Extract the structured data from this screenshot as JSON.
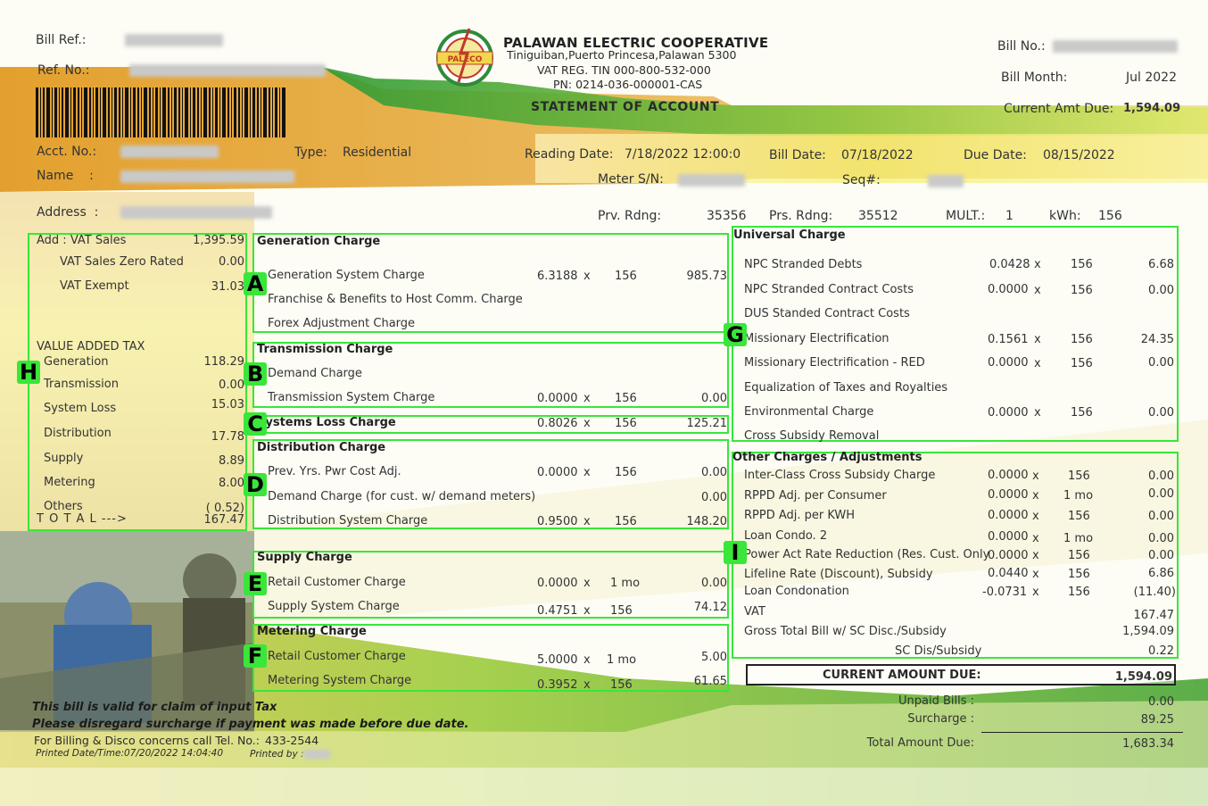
{
  "header": {
    "bill_ref_label": "Bill Ref.:",
    "ref_no_label": "Ref. No.:",
    "coop_name": "PALAWAN ELECTRIC COOPERATIVE",
    "coop_address": "Tiniguiban,Puerto Princesa,Palawan 5300",
    "vat_reg": "VAT REG. TIN 000-800-532-000",
    "pn": "PN: 0214-036-000001-CAS",
    "statement_title": "STATEMENT OF ACCOUNT",
    "logo_text": "PALECO",
    "bill_no_label": "Bill No.:",
    "bill_month_label": "Bill Month:",
    "bill_month": "Jul 2022",
    "current_amt_due_label": "Current Amt Due:",
    "current_amt_due": "1,594.09"
  },
  "account": {
    "acct_no_label": "Acct. No.:",
    "name_label": "Name    :",
    "address_label": "Address  :",
    "type_label": "Type:",
    "type": "Residential",
    "reading_date_label": "Reading Date:",
    "reading_date": "7/18/2022 12:00:0",
    "bill_date_label": "Bill Date:",
    "bill_date": "07/18/2022",
    "due_date_label": "Due Date:",
    "due_date": "08/15/2022",
    "meter_label": "Meter S/N:",
    "seq_label": "Seq#:",
    "prv_label": "Prv. Rdng:",
    "prv": "35356",
    "prs_label": "Prs. Rdng:",
    "prs": "35512",
    "mult_label": "MULT.:",
    "mult": "1",
    "kwh_label": "kWh:",
    "kwh": "156"
  },
  "vat_panel": {
    "add_vat_sales": "Add : VAT Sales",
    "add_vat_sales_val": "1,395.59",
    "zero_rated": "VAT Sales Zero Rated",
    "zero_rated_val": "0.00",
    "exempt": "VAT Exempt",
    "exempt_val": "31.03",
    "vat_title": "VALUE ADDED TAX",
    "items": [
      {
        "label": "Generation",
        "value": "118.29"
      },
      {
        "label": "Transmission",
        "value": "0.00"
      },
      {
        "label": "System Loss",
        "value": "15.03"
      },
      {
        "label": "Distribution",
        "value": "17.78"
      },
      {
        "label": "Supply",
        "value": "8.89"
      },
      {
        "label": "Metering",
        "value": "8.00"
      },
      {
        "label": "Others",
        "value": "( 0.52)"
      }
    ],
    "total_label": "T O T A L --->",
    "total_val": "167.47"
  },
  "generation": {
    "title": "Generation Charge",
    "r1": "Generation System Charge",
    "r1_rate": "6.3188",
    "r1_x": "x",
    "r1_qty": "156",
    "r1_amt": "985.73",
    "r2": "Franchise & Benefits to Host Comm. Charge",
    "r3": "Forex Adjustment Charge"
  },
  "transmission": {
    "title": "Transmission Charge",
    "r1": "Demand Charge",
    "r2": "Transmission System Charge",
    "r2_rate": "0.0000",
    "r2_x": "x",
    "r2_qty": "156",
    "r2_amt": "0.00"
  },
  "systems_loss": {
    "title": "Systems Loss Charge",
    "rate": "0.8026",
    "x": "x",
    "qty": "156",
    "amt": "125.21"
  },
  "distribution": {
    "title": "Distribution Charge",
    "r1": "Prev. Yrs. Pwr Cost Adj.",
    "r1_rate": "0.0000",
    "r1_x": "x",
    "r1_qty": "156",
    "r1_amt": "0.00",
    "r2": "Demand Charge (for cust. w/ demand meters)",
    "r2_amt": "0.00",
    "r3": "Distribution System Charge",
    "r3_rate": "0.9500",
    "r3_x": "x",
    "r3_qty": "156",
    "r3_amt": "148.20"
  },
  "supply": {
    "title": "Supply Charge",
    "r1": "Retail Customer Charge",
    "r1_rate": "0.0000",
    "r1_x": "x",
    "r1_qty": "1 mo",
    "r1_amt": "0.00",
    "r2": "Supply System Charge",
    "r2_rate": "0.4751",
    "r2_x": "x",
    "r2_qty": "156",
    "r2_amt": "74.12"
  },
  "metering": {
    "title": "Metering Charge",
    "r1": "Retail Customer Charge",
    "r1_rate": "5.0000",
    "r1_x": "x",
    "r1_qty": "1 mo",
    "r1_amt": "5.00",
    "r2": "Metering System Charge",
    "r2_rate": "0.3952",
    "r2_x": "x",
    "r2_qty": "156",
    "r2_amt": "61.65"
  },
  "universal": {
    "title": "Universal Charge",
    "rows": [
      {
        "label": "NPC Stranded Debts",
        "rate": "0.0428",
        "x": "x",
        "qty": "156",
        "amt": "6.68"
      },
      {
        "label": "NPC Stranded Contract Costs",
        "rate": "0.0000",
        "x": "x",
        "qty": "156",
        "amt": "0.00"
      },
      {
        "label": "DUS Standed Contract Costs",
        "rate": "",
        "x": "",
        "qty": "",
        "amt": ""
      },
      {
        "label": "Missionary Electrification",
        "rate": "0.1561",
        "x": "x",
        "qty": "156",
        "amt": "24.35"
      },
      {
        "label": "Missionary Electrification - RED",
        "rate": "0.0000",
        "x": "x",
        "qty": "156",
        "amt": "0.00"
      },
      {
        "label": "Equalization of Taxes and Royalties",
        "rate": "",
        "x": "",
        "qty": "",
        "amt": ""
      },
      {
        "label": "Environmental Charge",
        "rate": "0.0000",
        "x": "x",
        "qty": "156",
        "amt": "0.00"
      },
      {
        "label": "Cross Subsidy Removal",
        "rate": "",
        "x": "",
        "qty": "",
        "amt": ""
      }
    ]
  },
  "other": {
    "title": "Other Charges / Adjustments",
    "rows": [
      {
        "label": "Inter-Class Cross Subsidy Charge",
        "rate": "0.0000",
        "x": "x",
        "qty": "156",
        "amt": "0.00"
      },
      {
        "label": "RPPD Adj. per Consumer",
        "rate": "0.0000",
        "x": "x",
        "qty": "1 mo",
        "amt": "0.00"
      },
      {
        "label": "RPPD Adj. per KWH",
        "rate": "0.0000",
        "x": "x",
        "qty": "156",
        "amt": "0.00"
      },
      {
        "label": "Loan Condo. 2",
        "rate": "0.0000",
        "x": "x",
        "qty": "1 mo",
        "amt": "0.00"
      },
      {
        "label": "Power Act Rate Reduction (Res. Cust. Only",
        "rate": "0.0000",
        "x": "x",
        "qty": "156",
        "amt": "0.00"
      },
      {
        "label": "Lifeline Rate (Discount), Subsidy",
        "rate": "0.0440",
        "x": "x",
        "qty": "156",
        "amt": "6.86"
      },
      {
        "label": "Loan Condonation",
        "rate": "-0.0731",
        "x": "x",
        "qty": "156",
        "amt": "(11.40)"
      }
    ],
    "vat_label": "VAT",
    "vat_amt": "167.47",
    "gross_label": "Gross Total Bill w/ SC Disc./Subsidy",
    "gross_amt": "1,594.09",
    "sc_label": "SC Dis/Subsidy",
    "sc_amt": "0.22"
  },
  "totals": {
    "current_label": "CURRENT AMOUNT DUE:",
    "current_amt": "1,594.09",
    "unpaid_label": "Unpaid Bills :",
    "unpaid_amt": "0.00",
    "surcharge_label": "Surcharge :",
    "surcharge_amt": "89.25",
    "total_label": "Total Amount Due:",
    "total_amt": "1,683.34"
  },
  "footer": {
    "note1": "This bill is valid for claim of input Tax",
    "note2": "Please disregard surcharge if payment was made before due date.",
    "tel_label": "For Billing & Disco concerns call Tel. No.:",
    "tel": "433-2544",
    "printed": "Printed Date/Time:07/20/2022 14:04:40",
    "printed_by": "Printed by :"
  },
  "tags": {
    "a": "A",
    "b": "B",
    "c": "C",
    "d": "D",
    "e": "E",
    "f": "F",
    "g": "G",
    "h": "H",
    "i": "I"
  },
  "colors": {
    "green": "#3aa52f",
    "orange": "#e8a53a",
    "yellow": "#e8e23a",
    "annotation": "#39e639"
  }
}
